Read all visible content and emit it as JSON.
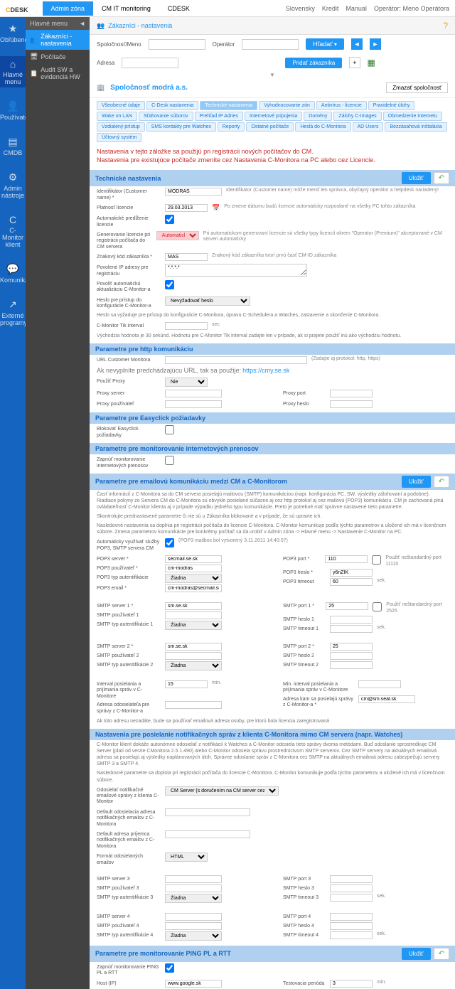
{
  "top": {
    "logo1": "C",
    "logo2": "DESK",
    "tab1": "Admin zóna",
    "tab2": "CM IT monitoring",
    "tab3": "CDESK",
    "slovensky": "Slovensky",
    "kredit": "Kredit",
    "manual": "Manual",
    "operator": "Operátor: Meno Operátora"
  },
  "leftnav": [
    "Obľúbené",
    "Hlavné menu",
    "Používatelia",
    "CMDB",
    "Admin nástroje",
    "C-Monitor klient",
    "Komunikácia",
    "Externé programy"
  ],
  "sidemenu": {
    "hdr": "Hlavné menu",
    "items": [
      "Zákazníci - nastavenia",
      "Počítače",
      "Audit SW a evidencia HW"
    ]
  },
  "breadcrumb": "Zákazníci - nastavenia",
  "search": {
    "spol": "Spoločnosť/Meno",
    "oper": "Operátor",
    "adresa": "Adresa",
    "hladat": "Hľadať",
    "pridat": "Pridať zákazníka"
  },
  "company": {
    "name": "Spoločnosť modrá a.s.",
    "del": "Zmazať spoločnosť"
  },
  "tabs": [
    "Všeobecné údaje",
    "C-Desk nastavenia",
    "Technické nastavenia",
    "Vyhodnocovanie zón",
    "Antivírus - licencie",
    "Pravidelné úlohy",
    "Wake on LAN",
    "Sťahovanie súborov",
    "Prehľad IP Adries",
    "Internetové pripojenia",
    "Domény",
    "Zálohy C-Images",
    "Obmedzenie Internetu",
    "Vzdialený prístup",
    "SMS kontakty pre Watches",
    "Reporty",
    "Ostatné počítače",
    "Heslá do C-Monitora",
    "AD Users",
    "Bezzásahová inštalácia",
    "Účtovný systém"
  ],
  "warn1": "Nastavenia v tejto záložke sa použijú pri registrácii nových počítačov do CM.",
  "warn2": "Nastavenia pre existujúce počítače zmeníte cez Nastavenia C-Monitora na PC alebo cez Licencie.",
  "sec1": {
    "title": "Technické nastavenia",
    "save": "Uložiť"
  },
  "f": {
    "ident_l": "Identifikátor (Customer name) *",
    "ident_v": "MODRAS",
    "ident_h": "Identifikátor (Customer name) môže meniť len správca, obyčajný operátor a helpdesk nariadený!",
    "plat_l": "Platnosť licencie",
    "plat_v": "29.03.2013",
    "plat_h": "Po zmene dátumu budú licencie automaticky rozposlané na všetky PC tohto zákazníka",
    "auto_l": "Automatické predĺženie licencie",
    "gen_l": "Generovanie licencie pri registrácii počítača do CM servera",
    "gen_v": "Automaticky",
    "gen_h": "Pri automatickom generovaní licencie sú všetky typy licencií okrem \"Operator (Premium)\" akceptované v CM serveri automaticky",
    "znak_l": "Znakový kód zákazníka *",
    "znak_v": "MAS",
    "znak_h": "Znakový kód zákazníka tvorí prvú časť CM-ID zákazníka",
    "ip_l": "Povolené IP adresy pre registráciu",
    "ip_v": "*.*.*.*",
    "aktual_l": "Povoliť automatickú aktualizáciu C-Monitor-a",
    "heslo_l": "Heslo pre prístup do konfigurácie C-Monitor-a",
    "heslo_ph": "Nevyžadovať heslo",
    "heslo_h": "Heslo sa vyžaduje pre prístup do konfigurácie C-Monitora, úpravu C-Schedulera a Watches, zastavenie a skončenie C-Monitora.",
    "tik_l": "C-Monitor Tik interval",
    "tik_u": "sec",
    "tik_h": "Východzia hodnota je 30 sekúnd. Hodnotu pre C-Monitor Tik interval zadajte len v prípade, ak si prajete použiť inú ako východziu hodnotu."
  },
  "sec2": "Parametre pre http komunikáciu",
  "http": {
    "url_l": "URL Customer Monitora",
    "url_h": "(Zadajte aj protokol: http, https)",
    "url_d": "Ak nevyplníte predchádzajúcu URL, tak sa použije:",
    "url_link": "https://cmy.se.sk",
    "proxy_l": "Použiť Proxy",
    "proxy_v": "Nie",
    "pserver_l": "Proxy server",
    "pport_l": "Proxy port",
    "puser_l": "Proxy používateľ",
    "pheslo_l": "Proxy heslo"
  },
  "sec3": "Parametre pre Easyclick požiadavky",
  "easy_l": "Blokovať Easyclick požiadavky",
  "sec4": "Parametre pre monitorovanie internetových prenosov",
  "mon_l": "Zapnúť monitorovanie internetových prenosov",
  "sec5": {
    "title": "Parametre pre emailovú komunikáciu medzi CM a C-Monitorom",
    "save": "Uložiť"
  },
  "mail_desc": "Časť informácií z C-Monitora sa do CM servera posielajú mailovou (SMTP) komunikáciou (napr. konfigurácia PC, SW, výsledky zálohovaní a podobne). Riadiace pokyny zo Servera CM do C-Monitora sú obvykle posielané súčasne aj cez http protokol aj cez mailovú (POP3) komunikáciu. CM je zachovaná plná ovládateľnosť C-Monitor klienta aj v prípade výpadku jedného typu komunikácie. Preto je potrebné mať správne nastavené tieto parametre.",
  "mail_desc2": "Skontrolujte prednastavené parametre či nie sú u Zákazníka blokované a v prípade, že sú upravte ich.",
  "mail_desc3": "Nasledovné nastavenia sa doplnia pri registrácii počítača do licencie C-Monitora. C-Monitor komunikuje podľa týchto parametrov a uložené ich má v licenčnom súbore. Zmena parametrov komunikácie pre konkrétny počítač sa dá urobiť v Admin zóna -> Hlavné menu -> Nastavenie C-Monitor na PC.",
  "pop3auto_l": "Automaticky využívať služby POP3, SMTP servera CM",
  "pop3auto_h": "(POP3 mailbox bol vytvorený 3.11.2011 14:40:07)",
  "pop3": {
    "server_l": "POP3 server *",
    "server_v": "secmail.se.sk",
    "port_l": "POP3 port *",
    "port_v": "110",
    "nonstd": "Použiť neštandardný port 11110",
    "user_l": "POP3 používateľ *",
    "user_v": "cm-modras",
    "heslo_l": "POP3 heslo *",
    "heslo_v": "y6nZIK",
    "auth_l": "POP3 typ autentifikácie",
    "auth_v": "Žiadna",
    "timeout_l": "POP3 timeout",
    "timeout_v": "60",
    "timeout_u": "sek.",
    "email_l": "POP3 email *",
    "email_v": "cm-modras@secmail.se.sk"
  },
  "smtp1": {
    "server_l": "SMTP server 1 *",
    "server_v": "sm.se.sk",
    "port_l": "SMTP port 1 *",
    "port_v": "25",
    "nonstd": "Použiť neštandardný port 2525",
    "user_l": "SMTP používateľ 1",
    "heslo_l": "SMTP heslo 1",
    "auth_l": "SMTP typ autentifikácie 1",
    "auth_v": "Žiadna",
    "timeout_l": "SMTP timeout 1",
    "timeout_u": "sek."
  },
  "smtp2": {
    "server_l": "SMTP server 2 *",
    "server_v": "sm.se.sk",
    "port_l": "SMTP port 2 *",
    "port_v": "25",
    "user_l": "SMTP používateľ 2",
    "heslo_l": "SMTP heslo 2",
    "auth_l": "SMTP typ autentifikácie 2",
    "auth_v": "Žiadna",
    "timeout_l": "SMTP timeout 2"
  },
  "interval": {
    "send_l": "Interval posielania a prijímania správ v C-Monitore",
    "send_v": "15",
    "send_u": "min.",
    "min_l": "Min. interval posielania a prijímania správ v C-Monitore",
    "addr_l": "Adresa odosielateľa pre správy z C-Monitor-a",
    "addr_h": "Ak túto adresu nezadáte, bude sa používať emailová adresa osoby, pre ktorú bola licencia zaregistrovaná",
    "to_l": "Adresa kam sa posielajú správy z C-Monitor-a *",
    "to_v": "cm@sm.seal.sk"
  },
  "sec6": "Nastavenia pre posielanie notifikačných správ z klienta C-Monitora mimo CM servera (napr. Watches)",
  "notif_desc": "C-Monitor klient dokáže autonómne odosielať z notifikácií k Watches a C-Monitor odosiela tieto správy dvoma metódami. Buď odoslanie sprostredkuje CM Server (platí od verzie CMonitora 2.5.1.490) alebo C-Monitor odosiela správu prostredníctvom SMTP serverov. Cez SMTP servery na aktuálnych emailová adresa sa posielajú aj výsledky naplánovaných úloh. Správne odoslanie správ z C-Monitora cez SMTP na aktuálnych emailová adresu zabezpečujú servery SMTP 3 a SMTP 4.",
  "notif_desc2": "Nasledovné parametre sa doplnia pri registrácii počítača do licencie C-Monitora. C-Monitor komunikuje podľa týchto parametrov a uložené ich má v licenčnom súbore.",
  "notif": {
    "method_l": "Odosielať notifikačné emailové správy z klienta C-Monitor",
    "method_v": "CM Server (s doručením na CM server cez HTTP)",
    "def1_l": "Default odosielacia adresa notifikačných emailov z C-Monitora",
    "def2_l": "Default adresa príjemca notifikačných emailov z C-Monitora",
    "format_l": "Formát odosielaných emailov",
    "format_v": "HTML"
  },
  "smtp3": {
    "server_l": "SMTP server 3",
    "port_l": "SMTP port 3",
    "user_l": "SMTP používateľ 3",
    "heslo_l": "SMTP heslo 3",
    "auth_l": "SMTP typ autentifikácie 3",
    "auth_v": "Žiadna",
    "timeout_l": "SMTP timeout 3",
    "timeout_u": "sek."
  },
  "smtp4": {
    "server_l": "SMTP server 4",
    "port_l": "SMTP port 4",
    "user_l": "SMTP používateľ 4",
    "heslo_l": "SMTP heslo 4",
    "auth_l": "SMTP typ autentifikácie 4",
    "auth_v": "Žiadna",
    "timeout_l": "SMTP timeout 4",
    "timeout_u": "sek."
  },
  "sec7": {
    "title": "Parametre pre monitorovanie PING PL a RTT",
    "save": "Uložiť"
  },
  "ping": {
    "on_l": "Zapnúť monitorovanie PING PL a RTT",
    "host_l": "Host (IP)",
    "host_v": "www.google.sk",
    "period_l": "Testovacia perióda",
    "period_v": "3",
    "period_u": "min."
  }
}
